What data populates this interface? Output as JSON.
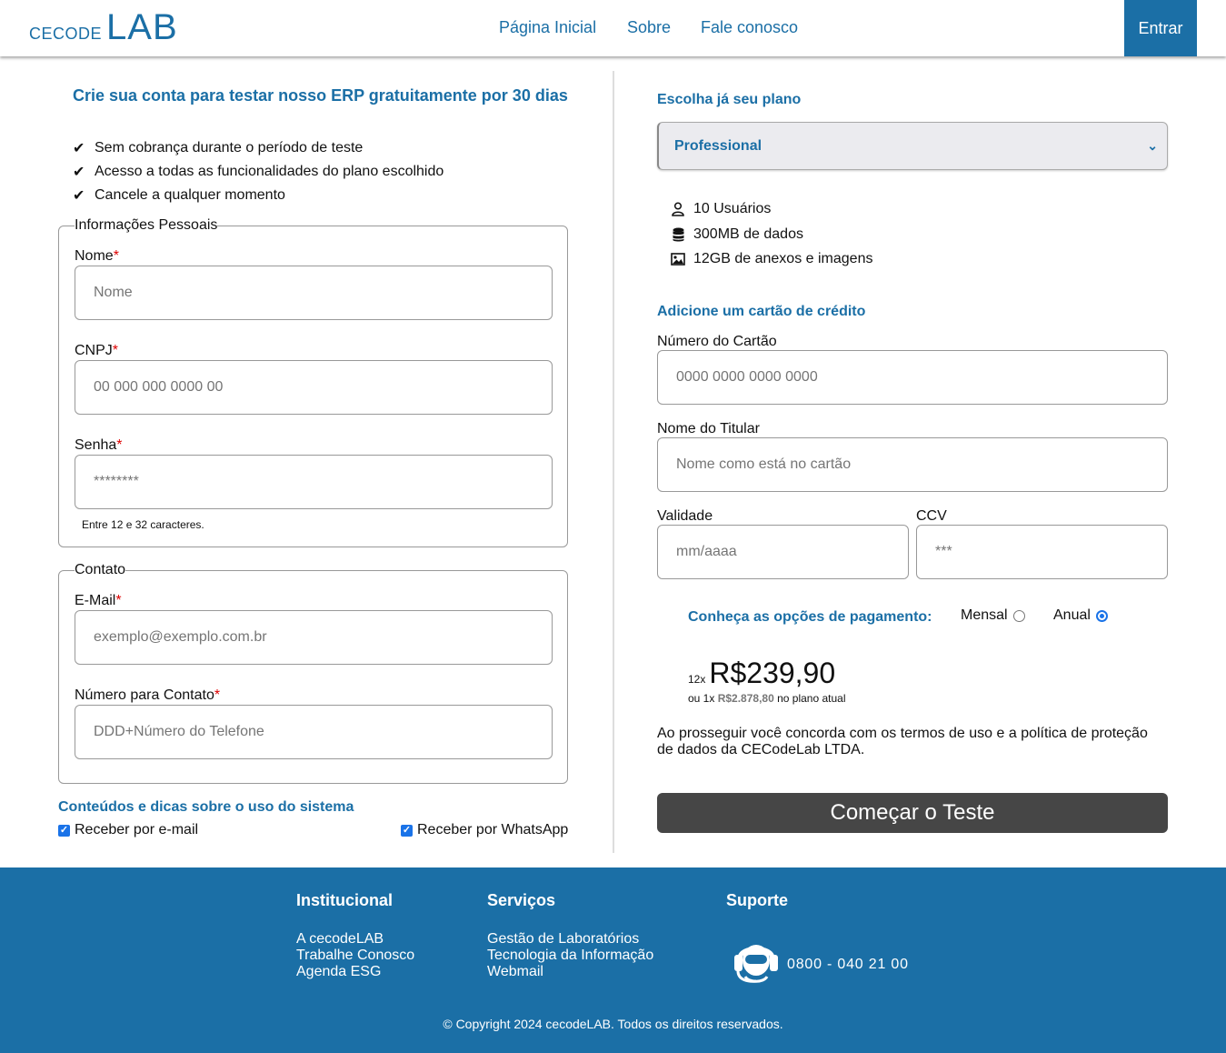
{
  "header": {
    "logo_small": "CECODE",
    "logo_big": "LAB",
    "nav": [
      "Página Inicial",
      "Sobre",
      "Fale conosco"
    ],
    "login_label": "Entrar"
  },
  "signup": {
    "title": "Crie sua conta para testar nosso ERP gratuitamente por 30 dias",
    "benefits": [
      "Sem cobrança durante o período de teste",
      "Acesso a todas as funcionalidades do plano escolhido",
      "Cancele a qualquer momento"
    ],
    "personal": {
      "legend": "Informações Pessoais",
      "name_label": "Nome",
      "name_placeholder": "Nome",
      "cnpj_label": "CNPJ",
      "cnpj_placeholder": "00 000 000 0000 00",
      "password_label": "Senha",
      "password_placeholder": "********",
      "password_hint": "Entre 12 e 32 caracteres."
    },
    "contact": {
      "legend": "Contato",
      "email_label": "E-Mail",
      "email_placeholder": "exemplo@exemplo.com.br",
      "phone_label": "Número para Contato",
      "phone_placeholder": "DDD+Número do Telefone"
    },
    "tips": {
      "heading": "Conteúdos e dicas sobre o uso do sistema",
      "email_option": "Receber por e-mail",
      "email_checked": true,
      "whatsapp_option": "Receber por WhatsApp",
      "whatsapp_checked": true
    },
    "required_mark": "*"
  },
  "plan": {
    "heading": "Escolha já seu plano",
    "selected": "Professional",
    "features": [
      {
        "icon": "user-icon",
        "text": "10 Usuários"
      },
      {
        "icon": "database-icon",
        "text": "300MB de dados"
      },
      {
        "icon": "image-icon",
        "text": "12GB de anexos e imagens"
      }
    ]
  },
  "card": {
    "heading": "Adicione um cartão de crédito",
    "number_label": "Número do Cartão",
    "number_placeholder": "0000 0000 0000 0000",
    "holder_label": "Nome do Titular",
    "holder_placeholder": "Nome como está no cartão",
    "expiry_label": "Validade",
    "expiry_placeholder": "mm/aaaa",
    "ccv_label": "CCV",
    "ccv_placeholder": "***"
  },
  "payment": {
    "heading": "Conheça as opções de pagamento:",
    "monthly": "Mensal",
    "annual": "Anual",
    "selected": "Anual",
    "installments": "12x",
    "price": "R$239,90",
    "total_prefix": "ou 1x",
    "total": "R$2.878,80",
    "total_suffix": "no plano atual"
  },
  "terms": "Ao prosseguir você concorda com os termos de uso e a política de proteção de dados da CECodeLab LTDA.",
  "start_button": "Começar o Teste",
  "footer": {
    "col1_title": "Institucional",
    "col1_links": [
      "A cecodeLAB",
      "Trabalhe Conosco",
      "Agenda ESG"
    ],
    "col2_title": "Serviços",
    "col2_links": [
      "Gestão de Laboratórios",
      "Tecnologia da Informação",
      "Webmail"
    ],
    "col3_title": "Suporte",
    "phone": "0800 - 040 21 00",
    "copyright": "© Copyright 2024 cecodeLAB. Todos os direitos reservados."
  },
  "colors": {
    "brand": "#1b6fa6",
    "button_dark": "#464646",
    "required": "#dd0000",
    "checkbox": "#1a73e8"
  }
}
